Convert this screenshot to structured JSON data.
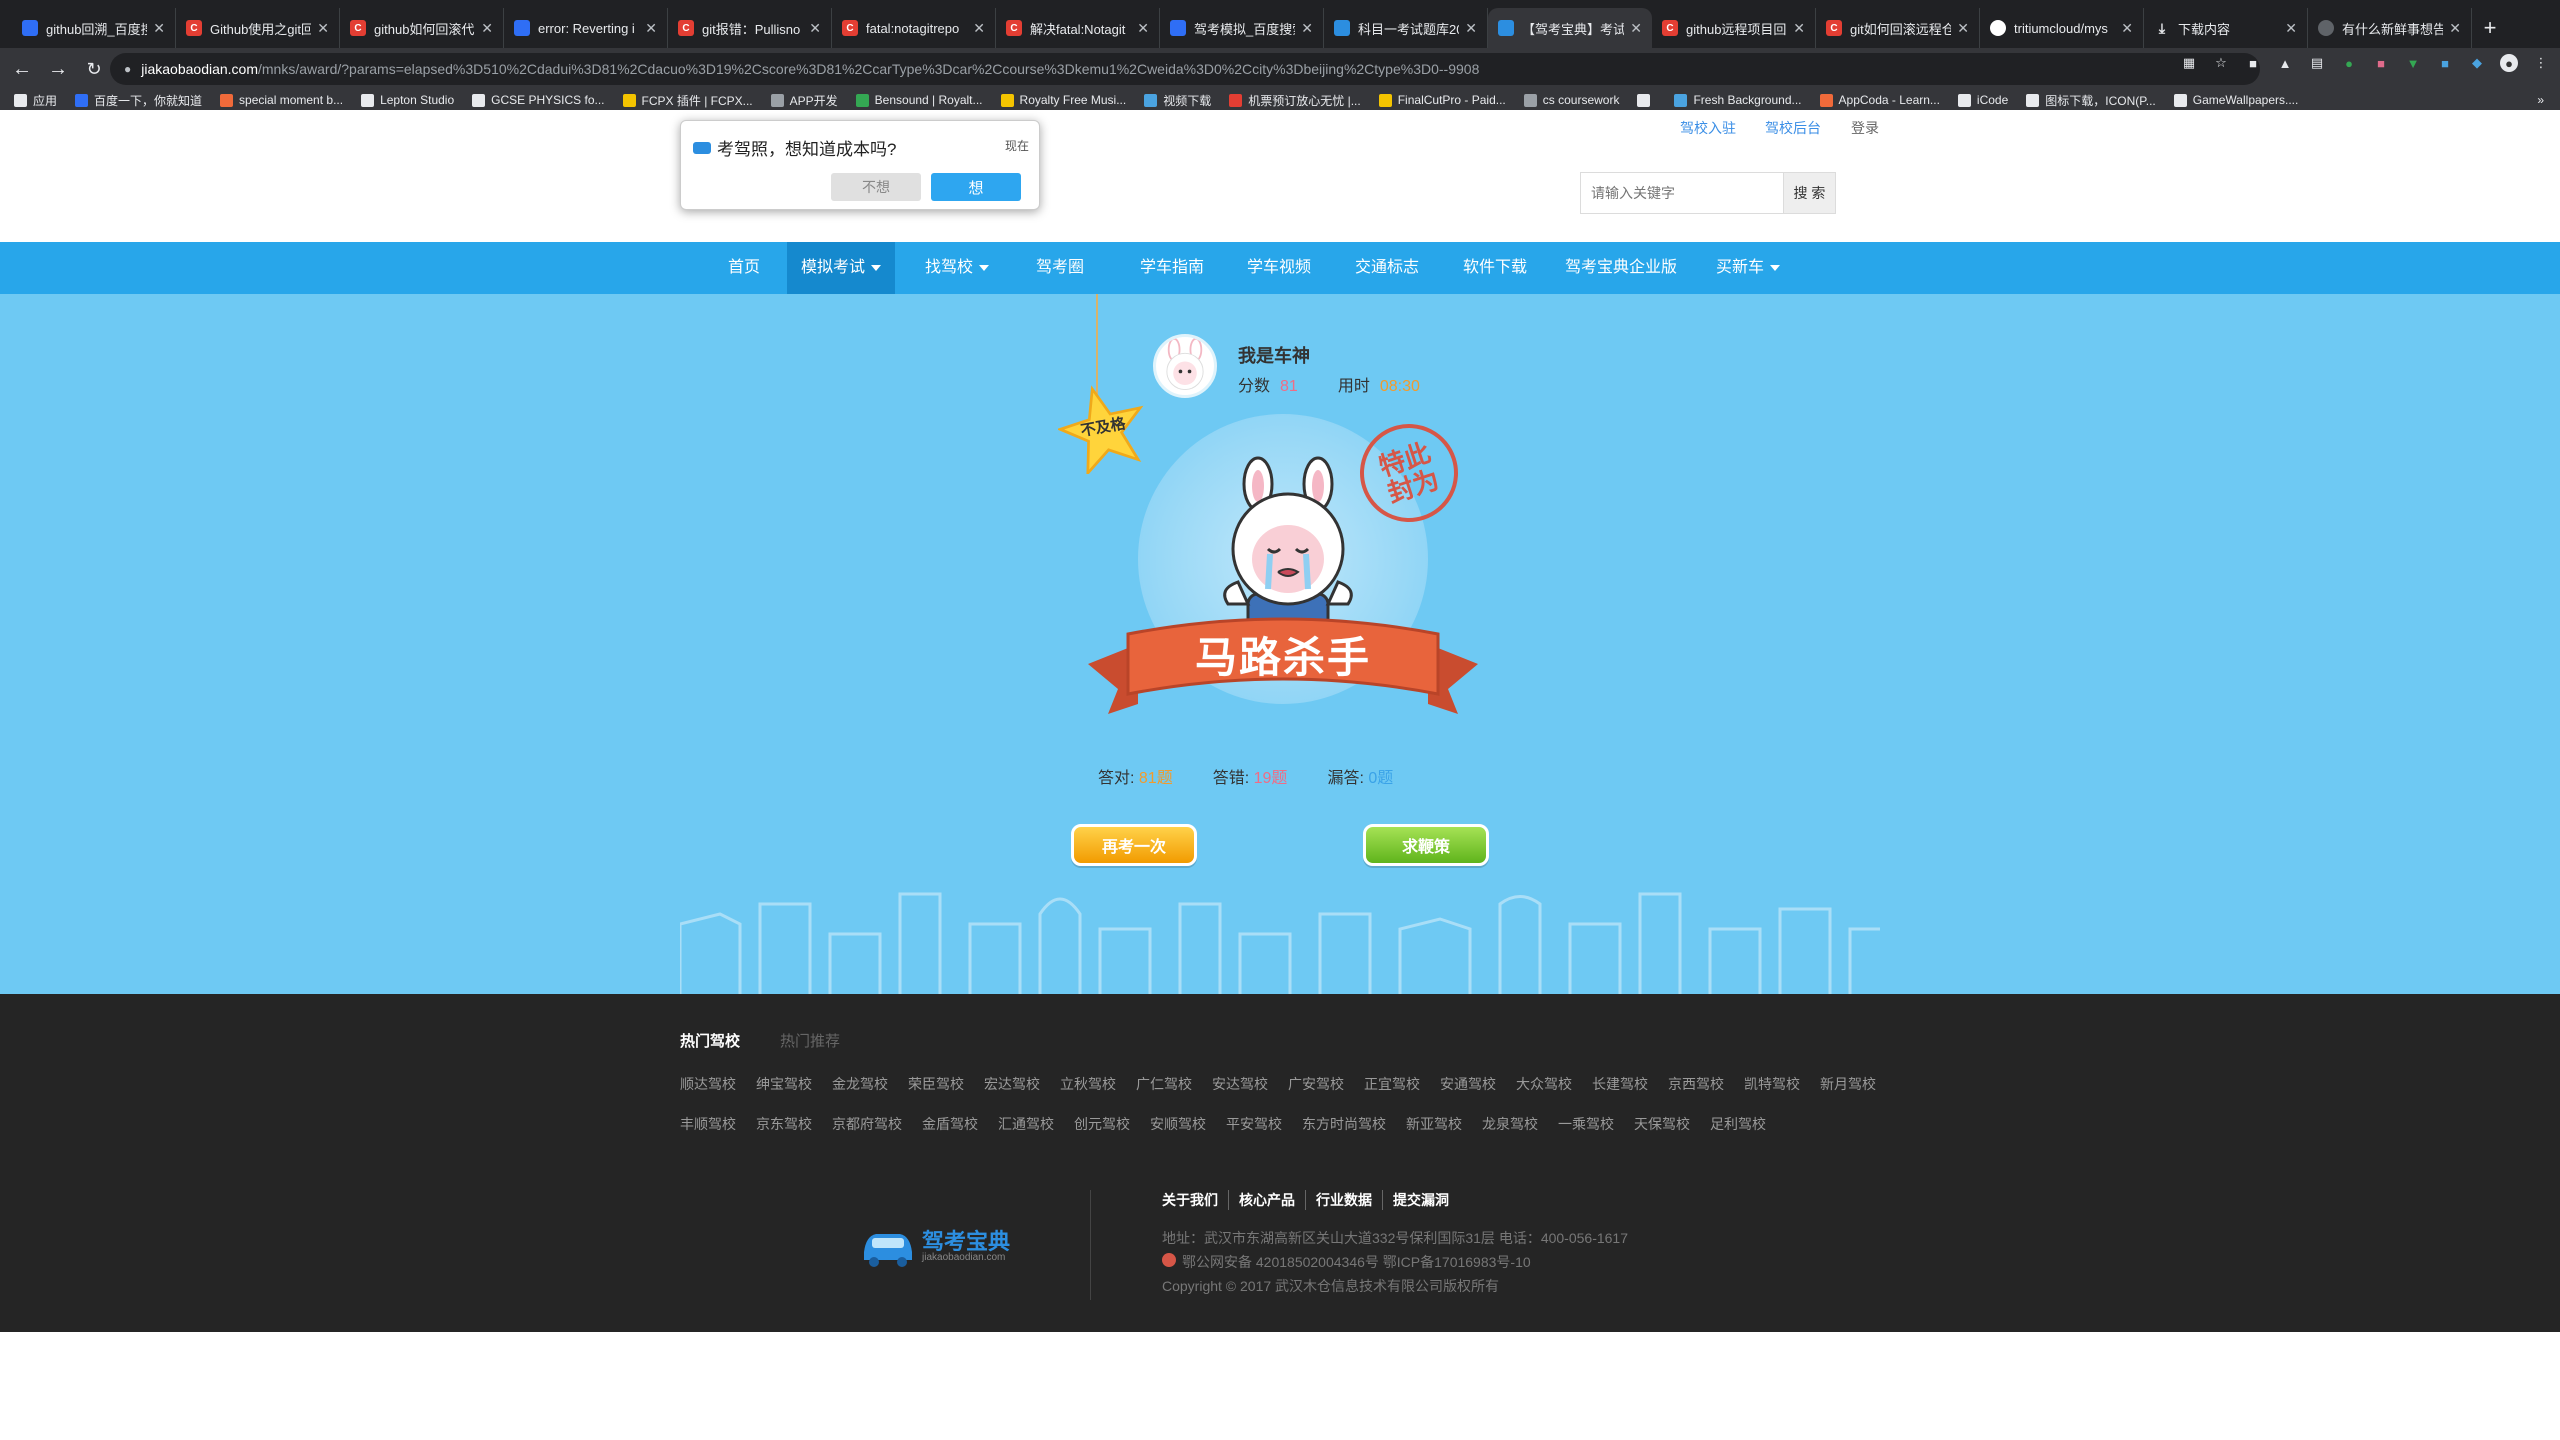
{
  "browser": {
    "tabs": [
      {
        "title": "github回溯_百度搜",
        "fav": "baidu"
      },
      {
        "title": "Github使用之git回",
        "fav": "csdn"
      },
      {
        "title": "github如何回滚代",
        "fav": "csdn"
      },
      {
        "title": "error: Reverting i",
        "fav": "baidu"
      },
      {
        "title": "git报错：Pullisno",
        "fav": "csdn"
      },
      {
        "title": "fatal:notagitrepo",
        "fav": "csdn"
      },
      {
        "title": "解决fatal:Notagit",
        "fav": "csdn"
      },
      {
        "title": "驾考模拟_百度搜索",
        "fav": "baidu"
      },
      {
        "title": "科目一考试题库20",
        "fav": "jk"
      },
      {
        "title": "【驾考宝典】考试",
        "fav": "jk",
        "active": true
      },
      {
        "title": "github远程项目回",
        "fav": "csdn"
      },
      {
        "title": "git如何回滚远程仓",
        "fav": "csdn"
      },
      {
        "title": "tritiumcloud/mys",
        "fav": "gh"
      },
      {
        "title": "下载内容",
        "fav": "dl"
      },
      {
        "title": "有什么新鲜事想告",
        "fav": "blank"
      }
    ],
    "new_tab": "+",
    "url_host": "jiakaobaodian.com",
    "url_path": "/mnks/award/?params=elapsed%3D510%2Cdadui%3D81%2Cdacuo%3D19%2Cscore%3D81%2CcarType%3Dcar%2Ccourse%3Dkemu1%2Cweida%3D0%2Ccity%3Dbeijing%2Ctype%3D0--9908",
    "bookmarks": [
      "应用",
      "百度一下，你就知道",
      "special moment b...",
      "Lepton Studio",
      "GCSE PHYSICS fo...",
      "FCPX 插件 | FCPX...",
      "APP开发",
      "Bensound | Royalt...",
      "Royalty Free Musi...",
      "视频下载",
      "机票预订放心无忧 |...",
      "FinalCutPro - Paid...",
      "cs coursework",
      "",
      "Fresh Background...",
      "AppCoda - Learn...",
      "iCode",
      "图标下载，ICON(P...",
      "GameWallpapers...."
    ],
    "more_bookmarks": "»"
  },
  "site": {
    "top_links": {
      "join": "驾校入驻",
      "admin": "驾校后台",
      "login": "登录"
    },
    "search": {
      "placeholder": "请输入关键字",
      "button": "搜 索"
    },
    "nav": [
      "首页",
      "模拟考试",
      "找驾校",
      "驾考圈",
      "学车指南",
      "学车视频",
      "交通标志",
      "软件下载",
      "驾考宝典企业版",
      "买新车"
    ],
    "nav_active_index": 1,
    "colors": {
      "nav_bg": "#28a6ea",
      "hero_bg": "#6ec9f3",
      "footer_bg": "#252525"
    }
  },
  "popup": {
    "title": "考驾照，想知道成本吗?",
    "time": "现在",
    "no": "不想",
    "yes": "想"
  },
  "result": {
    "user_name": "我是车神",
    "score_label": "分数",
    "score": "81",
    "time_label": "用时",
    "time": "08:30",
    "fail_badge": "不及格",
    "stamp": "特此封为",
    "title": "马路杀手",
    "correct_label": "答对:",
    "correct": "81题",
    "wrong_label": "答错:",
    "wrong": "19题",
    "missed_label": "漏答:",
    "missed": "0题",
    "retry_button": "再考一次",
    "help_button": "求鞭策"
  },
  "footer": {
    "tab_active": "热门驾校",
    "tab_inactive": "热门推荐",
    "row1": [
      "顺达驾校",
      "绅宝驾校",
      "金龙驾校",
      "荣臣驾校",
      "宏达驾校",
      "立秋驾校",
      "广仁驾校",
      "安达驾校",
      "广安驾校",
      "正宜驾校",
      "安通驾校",
      "大众驾校",
      "长建驾校",
      "京西驾校",
      "凯特驾校",
      "新月驾校"
    ],
    "row2": [
      "丰顺驾校",
      "京东驾校",
      "京都府驾校",
      "金盾驾校",
      "汇通驾校",
      "创元驾校",
      "安顺驾校",
      "平安驾校",
      "东方时尚驾校",
      "新亚驾校",
      "龙泉驾校",
      "一乘驾校",
      "天保驾校",
      "足利驾校"
    ],
    "logo_text": "驾考宝典",
    "logo_sub": "jiakaobaodian.com",
    "links": [
      "关于我们",
      "核心产品",
      "行业数据",
      "提交漏洞"
    ],
    "address": "地址：武汉市东湖高新区关山大道332号保利国际31层   电话：400-056-1617",
    "icp": "鄂公网安备 420185020043​46号  鄂ICP备17016983号-10",
    "copyright": "Copyright © 2017 武汉木仓信息技术有限公司版权所有"
  }
}
